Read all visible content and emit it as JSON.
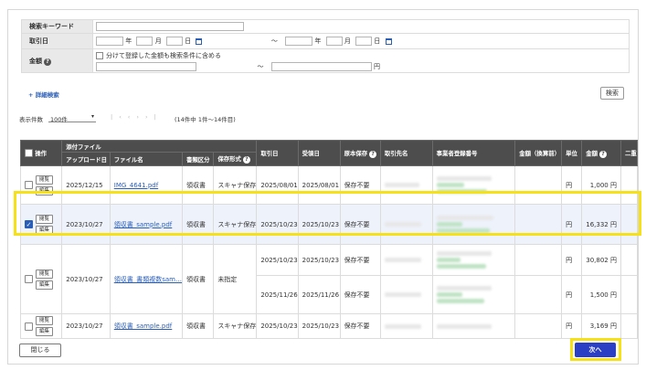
{
  "search": {
    "keyword_label": "検索キーワード",
    "date_label": "取引日",
    "amount_label": "金額",
    "year": "年",
    "month": "月",
    "day": "日",
    "tilde": "〜",
    "split_checkbox_label": "分けて登録した金額も検索条件に含める",
    "yen": "円",
    "advanced_link": "+ 詳細検索",
    "search_button": "検索"
  },
  "list_controls": {
    "count_label": "表示件数",
    "count_value": "100件",
    "pager_text": "(14件中 1件〜14件目)"
  },
  "headers": {
    "ops": "操作",
    "attached_group": "添付ファイル",
    "upload_date": "アップロード日",
    "file_name": "ファイル名",
    "doc_type": "書類区分",
    "save_format": "保存形式",
    "trade_date": "取引日",
    "received_date": "受領日",
    "original_save": "原本保存",
    "partner": "取引先名",
    "reg_no": "事業者登録番号",
    "amount_tax": "金額（換算前）",
    "unit": "単位",
    "amount": "金額",
    "next_col": "二重"
  },
  "rows": [
    {
      "ops": [
        "閲覧",
        "編集"
      ],
      "upload": "2025/12/15",
      "file": "IMG_4641.pdf",
      "doc": "領収書",
      "fmt": "スキャナ保存",
      "trade": "2025/08/01",
      "recv": "2025/08/01",
      "orig": "保存不要",
      "unit": "円",
      "amount": "1,000 円",
      "checked": false
    },
    {
      "ops": [
        "閲覧",
        "編集"
      ],
      "upload": "2023/10/27",
      "file": "領収書_sample.pdf",
      "doc": "領収書",
      "fmt": "スキャナ保存",
      "trade": "2025/10/23",
      "recv": "2025/10/23",
      "orig": "保存不要",
      "unit": "円",
      "amount": "16,332 円",
      "checked": true
    },
    {
      "ops": [
        "閲覧",
        "編集"
      ],
      "upload": "2023/10/27",
      "file": "領収書_書類複数sam…",
      "doc": "領収書",
      "fmt": "未指定",
      "sub": [
        {
          "trade": "2025/10/23",
          "recv": "2025/10/23",
          "orig": "保存不要",
          "unit": "円",
          "amount": "30,802 円"
        },
        {
          "trade": "2025/11/26",
          "recv": "2025/11/26",
          "orig": "保存不要",
          "unit": "円",
          "amount": "1,500 円"
        }
      ],
      "checked": false
    },
    {
      "ops": [
        "閲覧",
        "編集"
      ],
      "upload": "2023/10/27",
      "file": "領収書_sample.pdf",
      "doc": "領収書",
      "fmt": "スキャナ保存",
      "trade": "2025/10/23",
      "recv": "2025/10/23",
      "orig": "保存不要",
      "unit": "円",
      "amount": "3,169 円",
      "checked": false
    }
  ],
  "footer": {
    "close_button": "閉じる",
    "next_button": "次へ"
  },
  "colors": {
    "header_bg": "#4d4d4d",
    "accent": "#2b3fc4",
    "highlight": "#f6e017",
    "link": "#2b5fb7"
  }
}
